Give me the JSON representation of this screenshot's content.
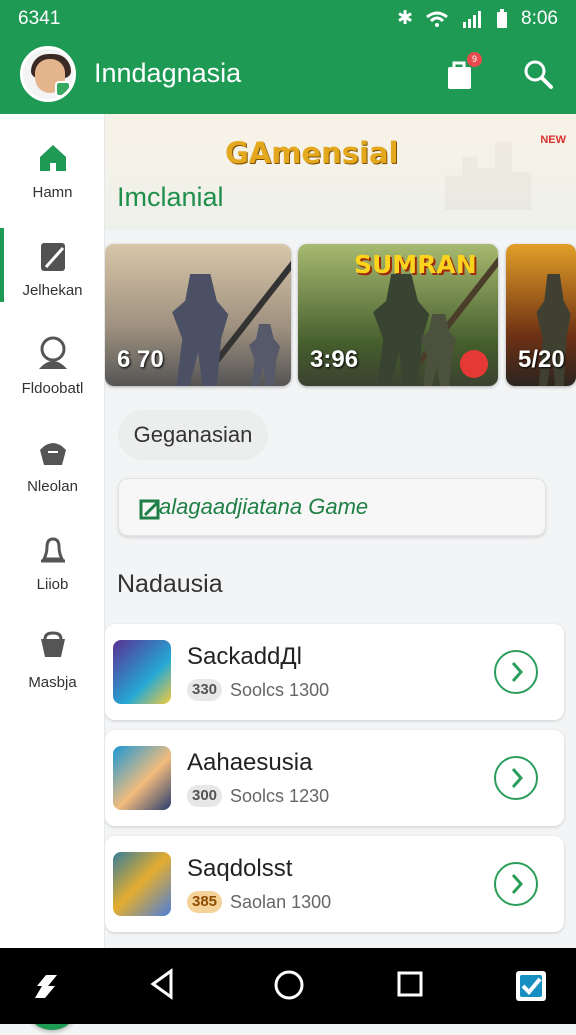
{
  "status": {
    "time": "6341",
    "clock": "8:06"
  },
  "app": {
    "title": "Inndagnasia",
    "notification_count": "9"
  },
  "sidebar": {
    "items": [
      {
        "label": "Hamn",
        "icon": "home-icon"
      },
      {
        "label": "Jelhekan",
        "icon": "pen-icon"
      },
      {
        "label": "Fldoobatl",
        "icon": "person-icon"
      },
      {
        "label": "Nleolan",
        "icon": "mask-icon"
      },
      {
        "label": "Liiob",
        "icon": "bell-icon"
      },
      {
        "label": "Masbja",
        "icon": "cart-icon"
      }
    ]
  },
  "hero": {
    "game": "GAmensial",
    "section": "Imclanial"
  },
  "cards": [
    {
      "label": "6 70",
      "title": ""
    },
    {
      "label": "3:96",
      "title": "SUMRAN"
    },
    {
      "label": "5/20",
      "title": ""
    }
  ],
  "chip": {
    "label": "Geganasian"
  },
  "featured": {
    "label": "alagaadjiatana Game"
  },
  "list": {
    "title": "Nadausia",
    "items": [
      {
        "name": "SackaddДl",
        "score": "330",
        "detail": "Soolcs 1300"
      },
      {
        "name": "Aahaesusia",
        "score": "300",
        "detail": "Soolcs 1230"
      },
      {
        "name": "Saqdolsst",
        "score": "385",
        "detail": "Saolan 1300"
      }
    ]
  },
  "colors": {
    "primary": "#1f9a55",
    "accent": "#e84b4b"
  }
}
